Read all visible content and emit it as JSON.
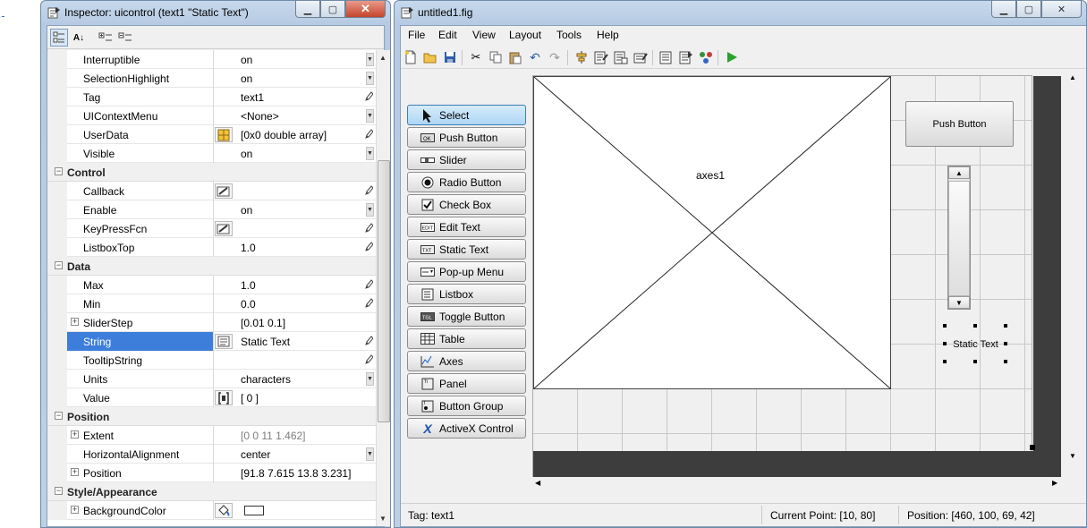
{
  "inspector": {
    "title": "Inspector:  uicontrol (text1 \"Static Text\")",
    "rows": [
      {
        "kind": "prop",
        "name": "Interruptible",
        "value": "on",
        "icon": "",
        "editor": "dropdown"
      },
      {
        "kind": "prop",
        "name": "SelectionHighlight",
        "value": "on",
        "icon": "",
        "editor": "dropdown"
      },
      {
        "kind": "prop",
        "name": "Tag",
        "value": "text1",
        "icon": "",
        "editor": "pencil"
      },
      {
        "kind": "prop",
        "name": "UIContextMenu",
        "value": "<None>",
        "icon": "",
        "editor": "dropdown"
      },
      {
        "kind": "prop",
        "name": "UserData",
        "value": "[0x0  double array]",
        "icon": "grid-icon",
        "editor": "pencil"
      },
      {
        "kind": "prop",
        "name": "Visible",
        "value": "on",
        "icon": "",
        "editor": "dropdown"
      },
      {
        "kind": "category",
        "name": "Control"
      },
      {
        "kind": "prop",
        "name": "Callback",
        "value": "",
        "icon": "callback-icon",
        "editor": "pencil"
      },
      {
        "kind": "prop",
        "name": "Enable",
        "value": "on",
        "icon": "",
        "editor": "dropdown"
      },
      {
        "kind": "prop",
        "name": "KeyPressFcn",
        "value": "",
        "icon": "callback-icon",
        "editor": "pencil"
      },
      {
        "kind": "prop",
        "name": "ListboxTop",
        "value": "1.0",
        "icon": "",
        "editor": "pencil"
      },
      {
        "kind": "category",
        "name": "Data"
      },
      {
        "kind": "prop",
        "name": "Max",
        "value": "1.0",
        "icon": "",
        "editor": "pencil"
      },
      {
        "kind": "prop",
        "name": "Min",
        "value": "0.0",
        "icon": "",
        "editor": "pencil"
      },
      {
        "kind": "prop",
        "name": "SliderStep",
        "value": "[0.01 0.1]",
        "icon": "",
        "editor": "",
        "expandable": true
      },
      {
        "kind": "prop",
        "name": "String",
        "value": "Static Text",
        "icon": "text-edit-icon",
        "editor": "pencil",
        "selected": true
      },
      {
        "kind": "prop",
        "name": "TooltipString",
        "value": "",
        "icon": "",
        "editor": "pencil"
      },
      {
        "kind": "prop",
        "name": "Units",
        "value": "characters",
        "icon": "",
        "editor": "dropdown"
      },
      {
        "kind": "prop",
        "name": "Value",
        "value": "[ 0 ]",
        "icon": "matrix-icon",
        "editor": ""
      },
      {
        "kind": "category",
        "name": "Position"
      },
      {
        "kind": "prop",
        "name": "Extent",
        "value": "[0 0 11 1.462]",
        "icon": "",
        "editor": "",
        "expandable": true,
        "gray": true
      },
      {
        "kind": "prop",
        "name": "HorizontalAlignment",
        "value": "center",
        "icon": "",
        "editor": "dropdown"
      },
      {
        "kind": "prop",
        "name": "Position",
        "value": "[91.8 7.615 13.8 3.231]",
        "icon": "",
        "editor": "",
        "expandable": true
      },
      {
        "kind": "category",
        "name": "Style/Appearance"
      },
      {
        "kind": "prop",
        "name": "BackgroundColor",
        "value": "",
        "icon": "paint-bucket-icon",
        "editor": "",
        "expandable": true,
        "swatch": "#ffffff"
      }
    ]
  },
  "guide": {
    "title": "untitled1.fig",
    "menu": [
      "File",
      "Edit",
      "View",
      "Layout",
      "Tools",
      "Help"
    ],
    "toolbar": [
      "new-icon",
      "open-icon",
      "save-icon",
      "cut-icon",
      "copy-icon",
      "paste-icon",
      "undo-icon",
      "redo-icon",
      "align-icon",
      "menu-editor-icon",
      "tab-order-icon",
      "toolbar-editor-icon",
      "editor-icon",
      "property-inspector-icon",
      "object-browser-icon",
      "run-icon"
    ],
    "palette": [
      {
        "label": "Select",
        "icon": "arrow-icon",
        "selected": true
      },
      {
        "label": "Push Button",
        "icon": "push-button-icon"
      },
      {
        "label": "Slider",
        "icon": "slider-icon"
      },
      {
        "label": "Radio Button",
        "icon": "radio-button-icon"
      },
      {
        "label": "Check Box",
        "icon": "check-box-icon"
      },
      {
        "label": "Edit Text",
        "icon": "edit-text-icon"
      },
      {
        "label": "Static Text",
        "icon": "static-text-icon"
      },
      {
        "label": "Pop-up Menu",
        "icon": "popup-menu-icon"
      },
      {
        "label": "Listbox",
        "icon": "listbox-icon"
      },
      {
        "label": "Toggle Button",
        "icon": "toggle-button-icon"
      },
      {
        "label": "Table",
        "icon": "table-icon"
      },
      {
        "label": "Axes",
        "icon": "axes-icon"
      },
      {
        "label": "Panel",
        "icon": "panel-icon"
      },
      {
        "label": "Button Group",
        "icon": "button-group-icon"
      },
      {
        "label": "ActiveX Control",
        "icon": "activex-icon"
      }
    ],
    "canvas": {
      "axes_label": "axes1",
      "push_button_label": "Push Button",
      "static_text_label": "Static Text"
    },
    "status": {
      "tag": "Tag: text1",
      "current_point": "Current Point:  [10, 80]",
      "position": "Position: [460, 100, 69, 42]"
    }
  }
}
